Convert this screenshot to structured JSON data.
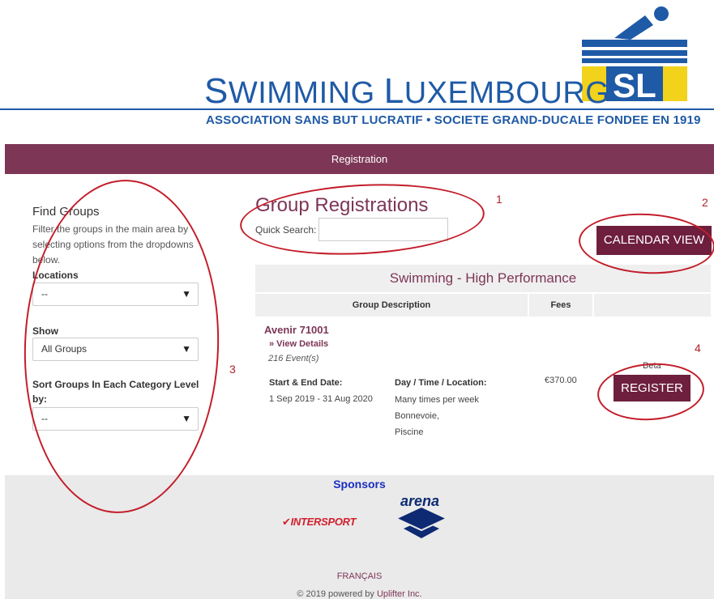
{
  "brand": {
    "title_s": "S",
    "title_rest1": "WIMMING ",
    "title_l": "L",
    "title_rest2": "UXEMBOURG",
    "subtitle": "ASSOCIATION SANS BUT LUCRATIF • SOCIETE GRAND-DUCALE FONDEE EN 1919",
    "logo_text": "SL",
    "colors": {
      "blue": "#1f5aa6",
      "yellow": "#f2d21b",
      "nav": "#7d3656",
      "button": "#6e1f3d"
    }
  },
  "nav": {
    "label": "Registration"
  },
  "sidebar": {
    "title": "Find Groups",
    "description": "Filter the groups in the main area by selecting options from the dropdowns below.",
    "locations_label": "Locations",
    "locations_value": "--",
    "show_label": "Show",
    "show_value": "All Groups",
    "sort_label": "Sort Groups In Each Category Level by:",
    "sort_value": "--",
    "caret_icon": "triangle-down-icon"
  },
  "main": {
    "title": "Group Registrations",
    "quick_search_label": "Quick Search:",
    "quick_search_value": "",
    "calendar_button": "CALENDAR VIEW",
    "category": "Swimming - High Performance",
    "columns": [
      "Group Description",
      "Fees"
    ],
    "group": {
      "name": "Avenir 71001",
      "view_details": "» View Details",
      "events": "216 Event(s)",
      "start_end_label": "Start & End Date:",
      "start_end_value": "1 Sep 2019 - 31 Aug 2020",
      "dtl_label": "Day / Time / Location:",
      "dtl_lines": [
        "Many times per week",
        "Bonnevoie,",
        "Piscine"
      ],
      "fee": "€370.00",
      "beta": "Beta",
      "register_button": "REGISTER"
    }
  },
  "footer": {
    "sponsors_title": "Sponsors",
    "sponsor_1": "INTERSPORT",
    "sponsor_2": "arena",
    "language_link": "FRANÇAIS",
    "powered_prefix": "© 2019 powered by ",
    "powered_link": "Uplifter Inc."
  },
  "annotations": [
    "1",
    "2",
    "3",
    "4"
  ]
}
